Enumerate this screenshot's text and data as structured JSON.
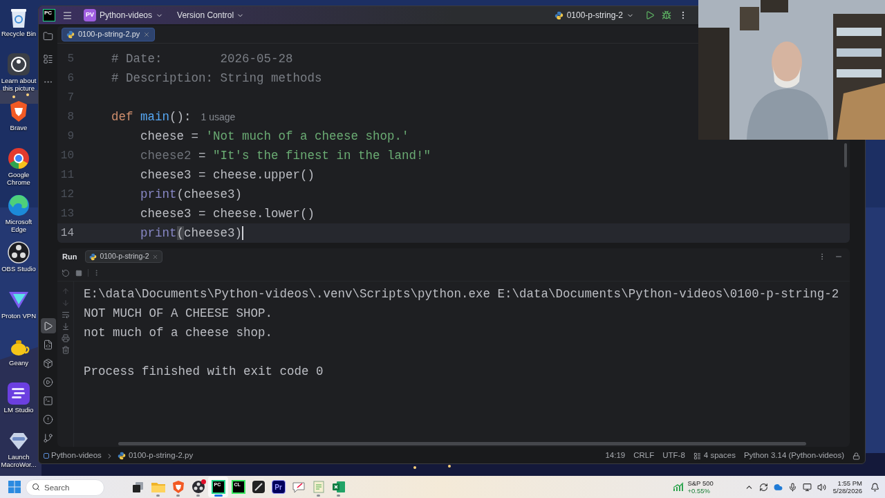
{
  "desktop_icons": [
    {
      "kind": "bin",
      "label": "Recycle Bin"
    },
    {
      "kind": "learn",
      "label": "Learn about this picture"
    },
    {
      "kind": "shield",
      "label": "Brave"
    },
    {
      "kind": "chrome",
      "label": "Google Chrome"
    },
    {
      "kind": "edge",
      "label": "Microsoft Edge"
    },
    {
      "kind": "obs",
      "label": "OBS Studio"
    },
    {
      "kind": "vpn",
      "label": "Proton VPN"
    },
    {
      "kind": "teapot",
      "label": "Geany"
    },
    {
      "kind": "lines",
      "label": "LM Studio"
    },
    {
      "kind": "blob",
      "label": "Launch MacroWor..."
    }
  ],
  "ide": {
    "logo_text": "PC",
    "project": {
      "badge": "PV",
      "name": "Python-videos"
    },
    "vcs": "Version Control",
    "run_config": "0100-p-string-2",
    "top_tools": [
      {
        "kind": "folder",
        "selected": false
      },
      {
        "kind": "structure",
        "selected": false
      },
      {
        "kind": "more",
        "selected": false
      }
    ],
    "bottom_tools": [
      {
        "kind": "run",
        "selected": true
      },
      {
        "kind": "console",
        "selected": false
      },
      {
        "kind": "packages",
        "selected": false
      },
      {
        "kind": "services",
        "selected": false
      },
      {
        "kind": "terminal",
        "selected": false
      },
      {
        "kind": "problems",
        "selected": false
      },
      {
        "kind": "git",
        "selected": false
      }
    ],
    "editor": {
      "tabs": [
        {
          "label": "0100-p-string-2.py",
          "selected": true
        }
      ],
      "lines": [
        {
          "number": "5",
          "current": false,
          "tokens": [
            {
              "kind": "comment",
              "text": "# Date:        2026-05-28"
            }
          ]
        },
        {
          "number": "6",
          "current": false,
          "tokens": [
            {
              "kind": "comment",
              "text": "# Description: String methods"
            }
          ]
        },
        {
          "number": "7",
          "current": false
        },
        {
          "number": "8",
          "current": false,
          "tokens": [
            {
              "kind": "keyword",
              "text": "def "
            },
            {
              "kind": "function",
              "text": "main"
            },
            {
              "kind": "plain",
              "text": "():"
            }
          ],
          "hint": "1 usage",
          "children": [
            {
              "number": "9",
              "current": false,
              "tokens": [
                {
                  "kind": "plain",
                  "text": "cheese = "
                },
                {
                  "kind": "string",
                  "text": "'Not much of a cheese shop.'"
                }
              ]
            },
            {
              "number": "10",
              "current": false,
              "tokens": [
                {
                  "kind": "unused",
                  "text": "cheese2"
                },
                {
                  "kind": "plain",
                  "text": " = "
                },
                {
                  "kind": "string",
                  "text": "\"It's the finest in the land!\""
                }
              ]
            },
            {
              "number": "11",
              "current": false,
              "tokens": [
                {
                  "kind": "plain",
                  "text": "cheese3 = cheese.upper()"
                }
              ]
            },
            {
              "number": "12",
              "current": false,
              "tokens": [
                {
                  "kind": "builtin",
                  "text": "print"
                },
                {
                  "kind": "plain",
                  "text": "(cheese3)"
                }
              ]
            },
            {
              "number": "13",
              "current": false,
              "tokens": [
                {
                  "kind": "plain",
                  "text": "cheese3 = cheese.lower()"
                }
              ]
            },
            {
              "number": "14",
              "current": true,
              "tokens": [
                {
                  "kind": "builtin",
                  "text": "print"
                },
                {
                  "kind": "brace",
                  "text": "("
                },
                {
                  "kind": "plain",
                  "text": "cheese3)"
                }
              ]
            }
          ]
        }
      ]
    },
    "run_panel": {
      "title": "Run",
      "tabs": [
        {
          "label": "0100-p-string-2",
          "selected": true
        }
      ],
      "output": [
        [
          "E:\\data\\Documents\\Python-videos\\.venv\\Scripts\\python.exe E:\\data\\Documents\\Python-videos\\0100-p-string-2",
          "NOT MUCH OF A CHEESE SHOP.",
          "not much of a cheese shop."
        ],
        [
          "Process finished with exit code 0"
        ]
      ]
    },
    "status_bar": {
      "breadcrumbs": [
        "Python-videos",
        "0100-p-string-2.py"
      ],
      "position": "14:19",
      "line_separator": "CRLF",
      "encoding": "UTF-8",
      "indent": "4 spaces",
      "interpreter": "Python 3.14 (Python-videos)"
    }
  },
  "taskbar": {
    "search": {
      "placeholder": "Search"
    },
    "apps": [
      {
        "kind": "task_view",
        "running": false,
        "selected": false,
        "notification": false
      },
      {
        "kind": "explorer",
        "running": true,
        "selected": false,
        "notification": false
      },
      {
        "kind": "browser",
        "running": true,
        "selected": false,
        "notification": false
      },
      {
        "kind": "recorder",
        "running": true,
        "selected": false,
        "notification": true
      },
      {
        "kind": "ide",
        "glyph": "PC",
        "running": true,
        "selected": true,
        "notification": false
      },
      {
        "kind": "ide2",
        "glyph": "CL",
        "running": false,
        "selected": false,
        "notification": false
      },
      {
        "kind": "dark_app",
        "running": false,
        "selected": false,
        "notification": false
      },
      {
        "kind": "video",
        "glyph": "Pr",
        "running": false,
        "selected": false,
        "notification": false
      },
      {
        "kind": "chat",
        "running": false,
        "selected": false,
        "notification": false
      },
      {
        "kind": "notepad",
        "running": true,
        "selected": false,
        "notification": false
      },
      {
        "kind": "sheet",
        "running": true,
        "selected": false,
        "notification": false
      }
    ],
    "stock": {
      "name": "S&P 500",
      "change": "+0.55%"
    },
    "clock": {
      "time": "1:55 PM",
      "date": "5/28/2026"
    }
  }
}
